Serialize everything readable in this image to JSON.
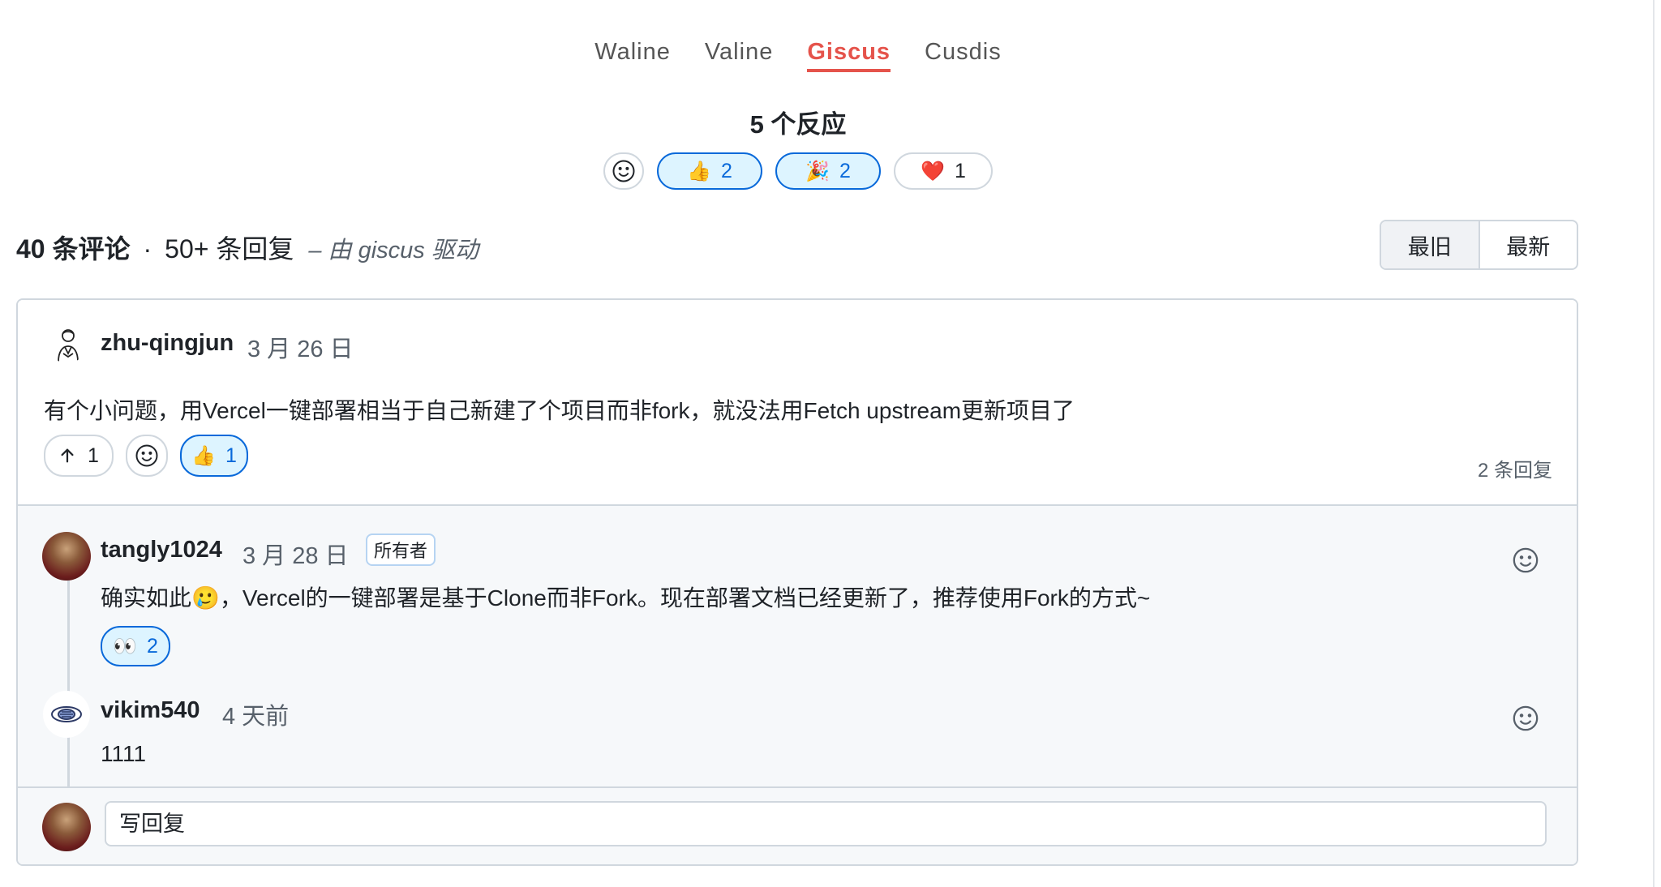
{
  "tabs": [
    {
      "label": "Waline"
    },
    {
      "label": "Valine"
    },
    {
      "label": "Giscus"
    },
    {
      "label": "Cusdis"
    }
  ],
  "reactions": {
    "title": "5 个反应",
    "items": [
      {
        "emoji": "👍",
        "count": "2"
      },
      {
        "emoji": "🎉",
        "count": "2"
      },
      {
        "emoji": "❤️",
        "count": "1"
      }
    ]
  },
  "header": {
    "comments": "40 条评论",
    "separator": "·",
    "replies": "50+ 条回复",
    "powered_by": "– 由 giscus 驱动"
  },
  "sort": {
    "oldest": "最旧",
    "newest": "最新"
  },
  "comment": {
    "author": "zhu-qingjun",
    "date": "3 月 26 日",
    "body": "有个小问题，用Vercel一键部署相当于自己新建了个项目而非fork，就没法用Fetch upstream更新项目了",
    "upvotes": "1",
    "thumbs": {
      "emoji": "👍",
      "count": "1"
    },
    "reply_count": "2 条回复"
  },
  "replies": [
    {
      "author": "tangly1024",
      "date": "3 月 28 日",
      "badge": "所有者",
      "body": "确实如此🥲，Vercel的一键部署是基于Clone而非Fork。现在部署文档已经更新了，推荐使用Fork的方式~",
      "reaction": {
        "emoji": "👀",
        "count": "2"
      }
    },
    {
      "author": "vikim540",
      "date": "4 天前",
      "body": "1111"
    }
  ],
  "reply_input": {
    "placeholder": "写回复"
  },
  "colors": {
    "accent": "#e5534b",
    "link_blue": "#0969da",
    "selected_bg": "#ddf4ff",
    "border": "#d0d7de",
    "reply_bg": "#f6f8fa"
  }
}
